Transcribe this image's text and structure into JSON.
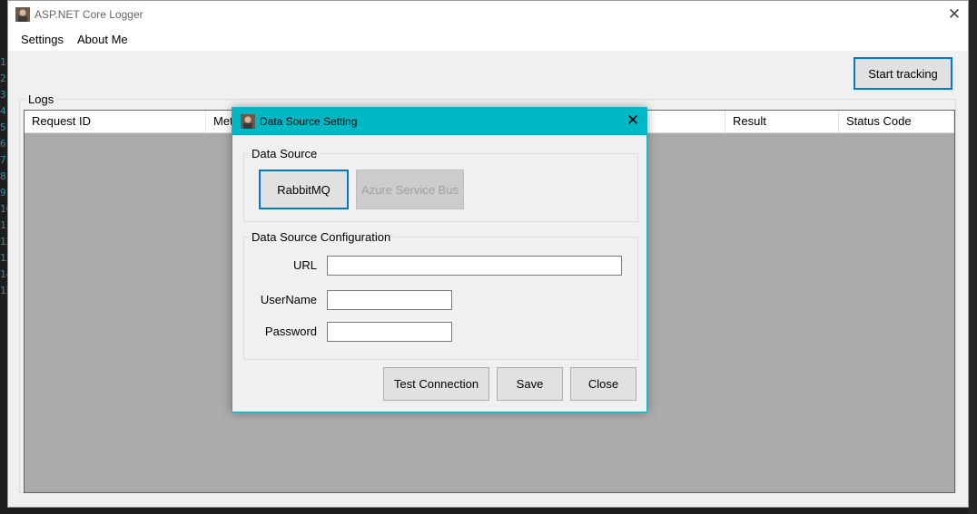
{
  "background": {
    "line_numbers": [
      "1",
      "2",
      "3",
      "4",
      "5",
      "6",
      "7",
      "8",
      "9",
      "10",
      "11",
      "12",
      "13",
      "14",
      "15"
    ]
  },
  "window": {
    "title": "ASP.NET Core Logger",
    "close_glyph": "✕"
  },
  "menu": {
    "items": [
      "Settings",
      "About Me"
    ]
  },
  "toolbar": {
    "start_label": "Start tracking"
  },
  "logs": {
    "group_label": "Logs",
    "columns": [
      "Request ID",
      "Method",
      "Result",
      "Status Code"
    ]
  },
  "dialog": {
    "title": "Data Source Setting",
    "close_glyph": "✕",
    "data_source": {
      "label": "Data Source",
      "rabbitmq_label": "RabbitMQ",
      "azure_label": "Azure Service Bus"
    },
    "config": {
      "label": "Data Source Configuration",
      "url_label": "URL",
      "url_value": "",
      "username_label": "UserName",
      "username_value": "",
      "password_label": "Password",
      "password_value": ""
    },
    "buttons": {
      "test_label": "Test Connection",
      "save_label": "Save",
      "close_label": "Close"
    }
  },
  "colors": {
    "accent": "#0078d7",
    "dialog_title": "#00b7c3",
    "grid_bg": "#ababab"
  },
  "icons": {
    "app": "user-avatar-icon",
    "close": "close-icon"
  }
}
